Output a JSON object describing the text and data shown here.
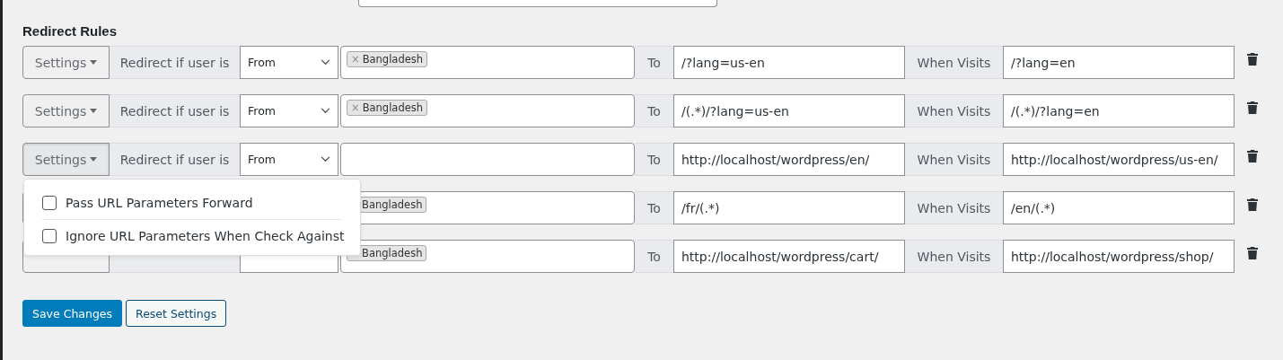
{
  "section_title": "Redirect Rules",
  "rules": [
    {
      "settings": "Settings",
      "condition_label": "Redirect if user is",
      "mode": "From",
      "menu_open": false,
      "tags": [
        {
          "remove": "×",
          "label": "Bangladesh"
        }
      ],
      "to_label": "To",
      "to": "/?lang=us-en",
      "visits_label": "When Visits",
      "visits": "/?lang=en"
    },
    {
      "settings": "Settings",
      "condition_label": "Redirect if user is",
      "mode": "From",
      "menu_open": false,
      "tags": [
        {
          "remove": "×",
          "label": "Bangladesh"
        }
      ],
      "to_label": "To",
      "to": "/(.*)/?lang=us-en",
      "visits_label": "When Visits",
      "visits": "/(.*)/?lang=en"
    },
    {
      "settings": "Settings",
      "condition_label": "Redirect if user is",
      "mode": "From",
      "to_label": "To",
      "to": "http://localhost/wordpress/en/",
      "visits_label": "When Visits",
      "visits": "http://localhost/wordpress/us-en/",
      "menu_open": true
    },
    {
      "tags": [
        {
          "label": "Bangladesh"
        }
      ],
      "to_label": "To",
      "to": "/fr/(.*)",
      "visits_label": "When Visits",
      "visits": "/en/(.*)"
    },
    {
      "tags": [
        {
          "label": "Bangladesh"
        }
      ],
      "to_label": "To",
      "to": "http://localhost/wordpress/cart/",
      "visits_label": "When Visits",
      "visits": "http://localhost/wordpress/shop/"
    }
  ],
  "settings_menu": [
    {
      "label": "Pass URL Parameters Forward",
      "checked": false
    },
    {
      "label": "Ignore URL Parameters When Check Against",
      "checked": false
    }
  ],
  "buttons": [
    {
      "label": "Save Changes",
      "kind": "primary"
    },
    {
      "label": "Reset Settings",
      "kind": "secondary"
    }
  ]
}
